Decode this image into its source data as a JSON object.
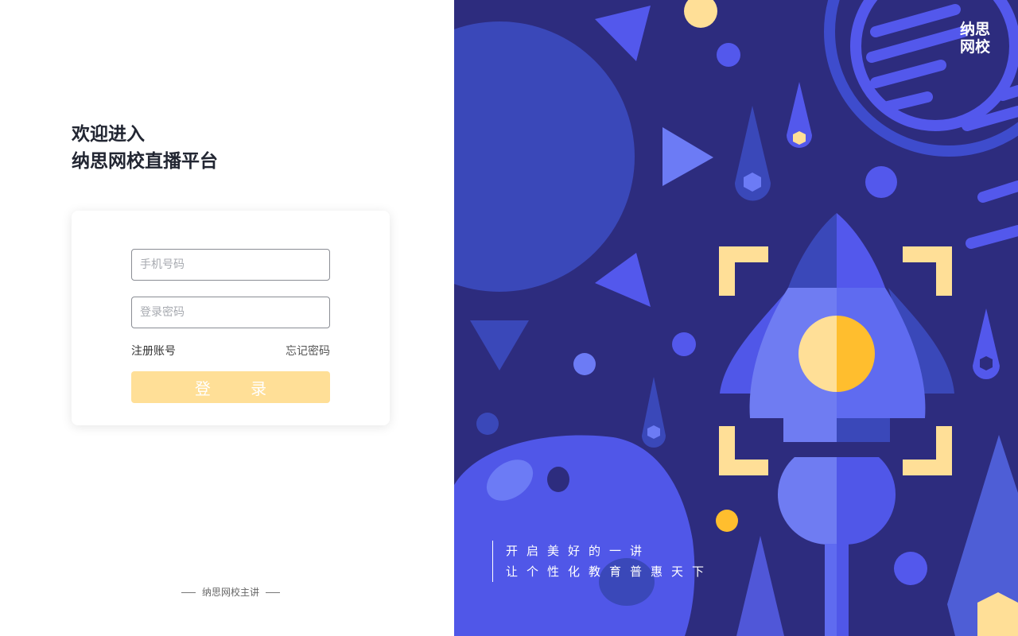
{
  "welcome": {
    "line1": "欢迎进入",
    "line2": "纳思网校直播平台"
  },
  "login_form": {
    "phone_placeholder": "手机号码",
    "password_placeholder": "登录密码",
    "register_link": "注册账号",
    "forgot_link": "忘记密码",
    "login_button": "登 录"
  },
  "footer": {
    "text": "纳思网校主讲"
  },
  "brand": {
    "logo_line1": "纳思",
    "logo_line2": "网校"
  },
  "slogan": {
    "line1": "开启美好的一讲",
    "line2": "让个性化教育普惠天下"
  },
  "icons": [
    "rocket-illustration",
    "planet-illustration",
    "bracket-icon"
  ],
  "colors": {
    "panel_bg": "#2d2c7e",
    "button_bg": "#ffdf97",
    "accent_yellow": "#ffbe2e",
    "accent_blue": "#5057e8"
  }
}
